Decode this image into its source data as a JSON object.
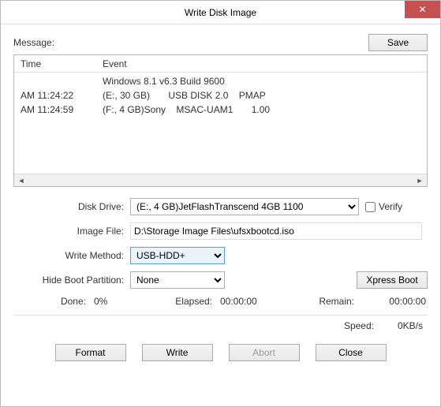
{
  "window": {
    "title": "Write Disk Image"
  },
  "message": {
    "label": "Message:",
    "save": "Save"
  },
  "log": {
    "headers": {
      "time": "Time",
      "event": "Event"
    },
    "rows": [
      {
        "time": "",
        "event": "Windows 8.1 v6.3 Build 9600"
      },
      {
        "time": "AM 11:24:22",
        "event": "(E:, 30 GB)       USB DISK 2.0    PMAP"
      },
      {
        "time": "AM 11:24:59",
        "event": "(F:, 4 GB)Sony    MSAC-UAM1       1.00"
      }
    ]
  },
  "form": {
    "disk_drive_label": "Disk Drive:",
    "disk_drive_value": "(E:, 4 GB)JetFlashTranscend 4GB   1100",
    "verify_label": "Verify",
    "image_file_label": "Image File:",
    "image_file_value": "D:\\Storage Image Files\\ufsxbootcd.iso",
    "write_method_label": "Write Method:",
    "write_method_value": "USB-HDD+",
    "hide_boot_label": "Hide Boot Partition:",
    "hide_boot_value": "None",
    "xpress_boot": "Xpress Boot"
  },
  "stats": {
    "done_label": "Done:",
    "done_value": "0%",
    "elapsed_label": "Elapsed:",
    "elapsed_value": "00:00:00",
    "remain_label": "Remain:",
    "remain_value": "00:00:00",
    "speed_label": "Speed:",
    "speed_value": "0KB/s"
  },
  "buttons": {
    "format": "Format",
    "write": "Write",
    "abort": "Abort",
    "close": "Close"
  }
}
